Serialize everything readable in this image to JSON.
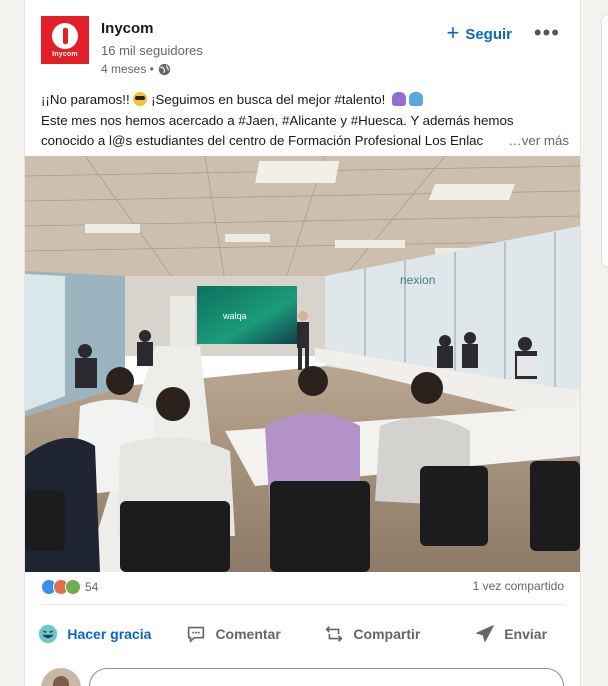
{
  "post": {
    "company_name": "Inycom",
    "logo_text": "Inycom",
    "followers": "16 mil seguidores",
    "time": "4 meses •",
    "follow_label": "Seguir",
    "more_label": "•••",
    "text_line1_a": "¡¡No paramos!! ",
    "text_line1_b": " ¡Seguimos en busca del mejor #talento! ",
    "text_line2": "Este mes nos hemos acercado a #Jaen, #Alicante y #Huesca. Y además hemos",
    "text_line3": "conocido a l@s estudiantes del centro de Formación Profesional Los Enlac",
    "see_more": "…ver más"
  },
  "image": {
    "screen_text": "walqa",
    "wall_text": "nexion"
  },
  "social": {
    "reaction_count": "54",
    "shares": "1 vez compartido"
  },
  "actions": [
    {
      "label": "Hacer gracia",
      "icon": "laugh-icon",
      "active": true
    },
    {
      "label": "Comentar",
      "icon": "comment-icon",
      "active": false
    },
    {
      "label": "Compartir",
      "icon": "repost-icon",
      "active": false
    },
    {
      "label": "Enviar",
      "icon": "send-icon",
      "active": false
    }
  ],
  "colors": {
    "accent": "#0a66c2",
    "brand": "#e41e26"
  }
}
